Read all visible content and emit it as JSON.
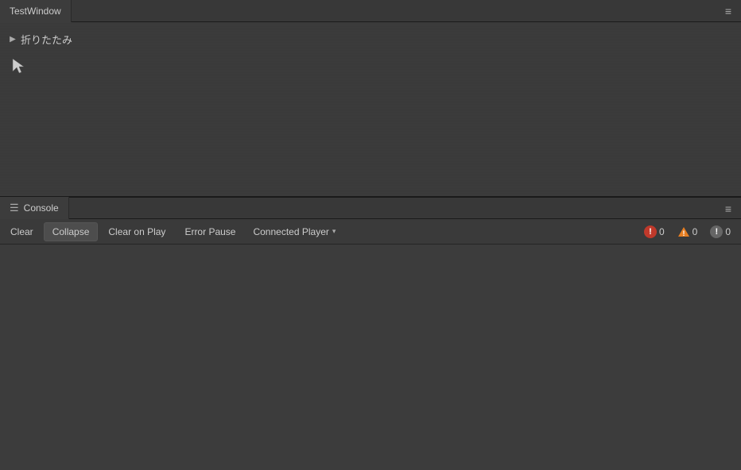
{
  "topPanel": {
    "tabLabel": "TestWindow",
    "menuIcon": "≡",
    "foldLabel": "折りたたみ",
    "foldArrow": "▶"
  },
  "bottomPanel": {
    "tabIcon": "☰",
    "tabLabel": "Console",
    "menuIcon": "≡"
  },
  "toolbar": {
    "clearLabel": "Clear",
    "collapseLabel": "Collapse",
    "clearOnPlayLabel": "Clear on Play",
    "errorPauseLabel": "Error Pause",
    "connectedPlayerLabel": "Connected Player",
    "dropdownArrow": "▾"
  },
  "logCounts": {
    "errorCount": "0",
    "warningCount": "0",
    "infoCount": "0",
    "errorIcon": "!",
    "warningIcon": "!",
    "infoIcon": "!"
  }
}
